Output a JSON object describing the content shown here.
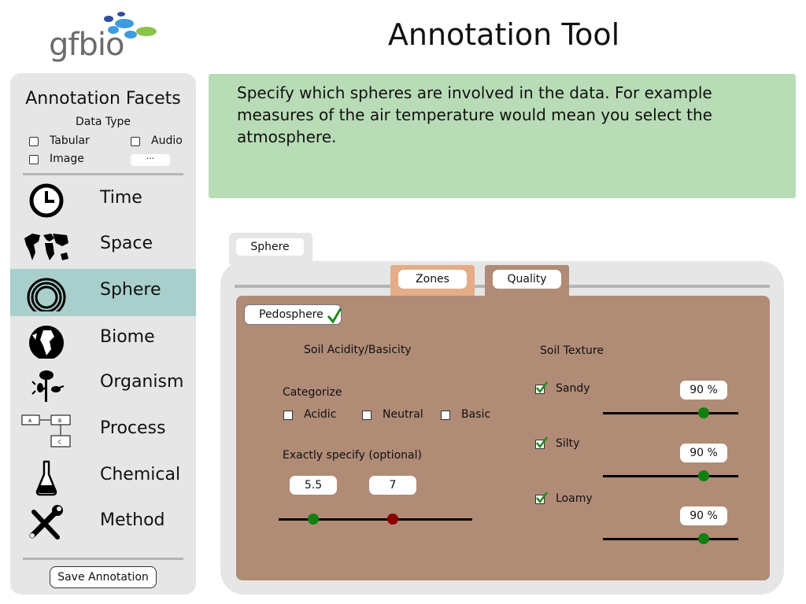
{
  "header": {
    "logo_text": "gfbio",
    "title": "Annotation Tool"
  },
  "sidebar": {
    "title": "Annotation Facets",
    "data_type": {
      "title": "Data Type",
      "options": [
        "Tabular",
        "Audio",
        "Image"
      ],
      "more_label": "···"
    },
    "facets": [
      {
        "label": "Time",
        "icon": "clock-icon"
      },
      {
        "label": "Space",
        "icon": "world-map-icon"
      },
      {
        "label": "Sphere",
        "icon": "sphere-rings-icon",
        "active": true
      },
      {
        "label": "Biome",
        "icon": "globe-icon"
      },
      {
        "label": "Organism",
        "icon": "organism-icon"
      },
      {
        "label": "Process",
        "icon": "process-diagram-icon"
      },
      {
        "label": "Chemical",
        "icon": "flask-icon"
      },
      {
        "label": "Method",
        "icon": "tools-icon"
      }
    ],
    "save_label": "Save Annotation"
  },
  "info": {
    "text": "Specify which spheres are involved in the data. For example measures of the air temperature would mean you select the atmosphere."
  },
  "panel": {
    "sphere_tab": "Sphere",
    "zones_tab": "Zones",
    "quality_tab": "Quality",
    "pedosphere": {
      "label": "Pedosphere",
      "checked": true
    },
    "acidity": {
      "title": "Soil  Acidity/Basicity",
      "categorize_label": "Categorize",
      "options": [
        "Acidic",
        "Neutral",
        "Basic"
      ],
      "exact_label": "Exactly specify (optional)",
      "min_value": "5.5",
      "max_value": "7"
    },
    "texture": {
      "title": "Soil Texture",
      "items": [
        {
          "label": "Sandy",
          "checked": true,
          "value": "90 %",
          "level": 0.75
        },
        {
          "label": "Silty",
          "checked": true,
          "value": "90 %",
          "level": 0.75
        },
        {
          "label": "Loamy",
          "checked": true,
          "value": "90 %",
          "level": 0.75
        }
      ]
    }
  },
  "colors": {
    "sidebar_bg": "#e6e6e6",
    "active_facet": "#a8cfcc",
    "info_bg": "#b8dcb6",
    "zones_tab": "#e5ac88",
    "content_bg": "#b08b76",
    "knob_green": "#108010",
    "knob_red": "#8b0000",
    "check_green": "#1f8a1f"
  }
}
